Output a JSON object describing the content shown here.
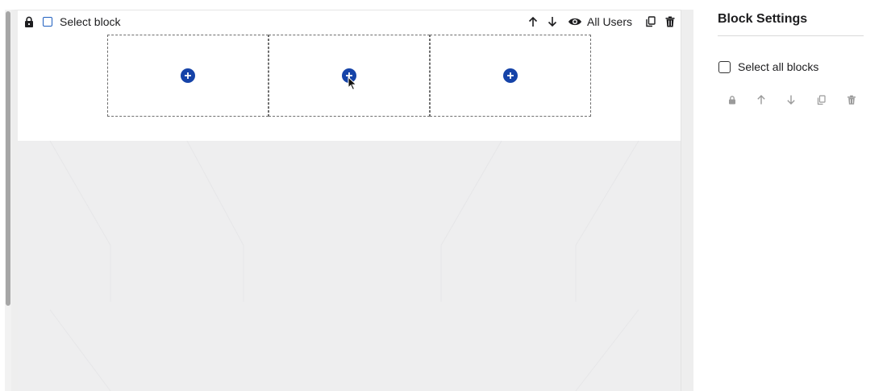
{
  "block": {
    "select_label": "Select block",
    "visibility_label": "All Users",
    "columns": [
      {
        "add_label": "add-content"
      },
      {
        "add_label": "add-content"
      },
      {
        "add_label": "add-content"
      }
    ]
  },
  "settings": {
    "title": "Block Settings",
    "select_all_label": "Select all blocks"
  },
  "colors": {
    "accent": "#1543a8",
    "hover_bg": "#dce8fb",
    "canvas_bg": "#eeeeef",
    "disabled_icon": "#9a9a9a"
  },
  "icons": {
    "toolbar": [
      "lock-icon",
      "checkbox",
      "arrow-up-icon",
      "arrow-down-icon",
      "eye-icon",
      "copy-icon",
      "trash-icon"
    ],
    "settings": [
      "lock-icon",
      "arrow-up-icon",
      "arrow-down-icon",
      "copy-icon",
      "trash-icon"
    ],
    "column": "plus-circle-icon"
  }
}
